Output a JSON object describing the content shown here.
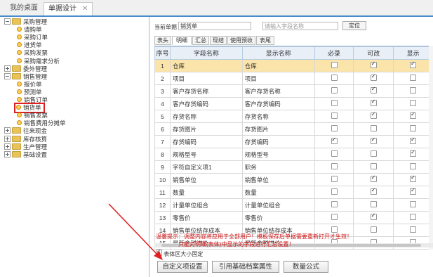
{
  "tabs": {
    "desktop": "我的桌面",
    "active": "单据设计",
    "close": "✕"
  },
  "tree": [
    {
      "label": "采购管理",
      "level": 0,
      "type": "folder",
      "open": true
    },
    {
      "label": "请购单",
      "level": 1,
      "type": "leaf"
    },
    {
      "label": "采购订单",
      "level": 1,
      "type": "leaf"
    },
    {
      "label": "进货单",
      "level": 1,
      "type": "leaf"
    },
    {
      "label": "采购发票",
      "level": 1,
      "type": "leaf"
    },
    {
      "label": "采购需求分析",
      "level": 1,
      "type": "leaf"
    },
    {
      "label": "委外管理",
      "level": 0,
      "type": "folder",
      "open": false
    },
    {
      "label": "销售管理",
      "level": 0,
      "type": "folder",
      "open": true
    },
    {
      "label": "报价单",
      "level": 1,
      "type": "leaf"
    },
    {
      "label": "预测单",
      "level": 1,
      "type": "leaf"
    },
    {
      "label": "销售订单",
      "level": 1,
      "type": "leaf"
    },
    {
      "label": "销货单",
      "level": 1,
      "type": "leaf",
      "highlight": true
    },
    {
      "label": "销售发票",
      "level": 1,
      "type": "leaf"
    },
    {
      "label": "销售费用分摊单",
      "level": 1,
      "type": "leaf"
    },
    {
      "label": "往来现金",
      "level": 0,
      "type": "folder",
      "open": false
    },
    {
      "label": "库存核算",
      "level": 0,
      "type": "folder",
      "open": false
    },
    {
      "label": "生产管理",
      "level": 0,
      "type": "folder",
      "open": false
    },
    {
      "label": "基础设置",
      "level": 0,
      "type": "folder",
      "open": false
    }
  ],
  "panel": {
    "current_label": "当前单据",
    "current_value": "销货单",
    "search_placeholder": "请输入字段名称",
    "locate_button": "定位",
    "subtabs": [
      "表头",
      "明细",
      "汇总",
      "现结",
      "使用预收",
      "表尾"
    ],
    "active_subtab": 1,
    "columns": [
      "序号",
      "字段名称",
      "显示名称",
      "必录",
      "可改",
      "显示"
    ],
    "rows": [
      {
        "n": "1",
        "field": "仓库",
        "disp": "仓库",
        "req": false,
        "edit": true,
        "show": true,
        "sel": true
      },
      {
        "n": "2",
        "field": "项目",
        "disp": "项目",
        "req": false,
        "edit": true,
        "show": false
      },
      {
        "n": "3",
        "field": "客户存货名称",
        "disp": "客户存货名称",
        "req": false,
        "edit": true,
        "show": false
      },
      {
        "n": "4",
        "field": "客户存货编码",
        "disp": "客户存货编码",
        "req": false,
        "edit": true,
        "show": false
      },
      {
        "n": "5",
        "field": "存货名称",
        "disp": "存货名称",
        "req": false,
        "edit": true,
        "show": true
      },
      {
        "n": "6",
        "field": "存货图片",
        "disp": "存货图片",
        "req": false,
        "edit": false,
        "show": false
      },
      {
        "n": "7",
        "field": "存货编码",
        "disp": "存货编码",
        "req": true,
        "edit": true,
        "show": true
      },
      {
        "n": "8",
        "field": "规格型号",
        "disp": "规格型号",
        "req": false,
        "edit": false,
        "show": true
      },
      {
        "n": "9",
        "field": "字符自定义项1",
        "disp": "职务",
        "req": false,
        "edit": false,
        "show": false
      },
      {
        "n": "10",
        "field": "销售单位",
        "disp": "销售单位",
        "req": false,
        "edit": true,
        "show": true
      },
      {
        "n": "11",
        "field": "数量",
        "disp": "数量",
        "req": false,
        "edit": true,
        "show": true
      },
      {
        "n": "12",
        "field": "计量单位组合",
        "disp": "计量单位组合",
        "req": false,
        "edit": false,
        "show": false
      },
      {
        "n": "13",
        "field": "零售价",
        "disp": "零售价",
        "req": false,
        "edit": true,
        "show": false
      },
      {
        "n": "14",
        "field": "销售单位结存成本",
        "disp": "销售单位结存成本",
        "req": false,
        "edit": false,
        "show": false
      },
      {
        "n": "15",
        "field": "最新含税进价",
        "disp": "最新含税进价",
        "req": false,
        "edit": false,
        "show": false
      }
    ],
    "hint_line1": "温馨提示：调整内容将应用于全部用户！模板保存后单据需要重新打开才生效！",
    "hint_line2": "只能对明细(表体)中显示的字段进行汇总设置！",
    "fixed_size_label": "表体区大小固定",
    "buttons": [
      "自定义项设置",
      "引用基础档案属性",
      "数量公式"
    ]
  },
  "colors": {
    "accent": "#4a8bc9",
    "selected_row": "#fbe4a9",
    "hint": "#d01010",
    "arrow": "#e02020"
  }
}
